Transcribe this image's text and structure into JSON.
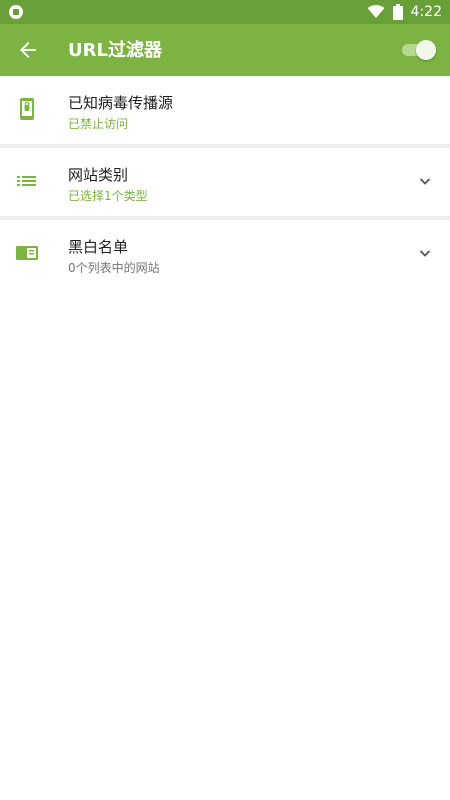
{
  "status_bar": {
    "time": "4:22"
  },
  "app_bar": {
    "title": "URL过滤器",
    "toggle_state": "on"
  },
  "list": {
    "items": [
      {
        "title": "已知病毒传播源",
        "subtitle": "已禁止访问",
        "subtitle_color": "#7cb342",
        "icon": "phone-shield-icon",
        "expandable": false
      },
      {
        "title": "网站类别",
        "subtitle": "已选择1个类型",
        "subtitle_color": "#7cb342",
        "icon": "list-icon",
        "expandable": true
      },
      {
        "title": "黑白名单",
        "subtitle": "0个列表中的网站",
        "subtitle_color": "#757575",
        "icon": "card-list-icon",
        "expandable": true
      }
    ]
  },
  "colors": {
    "primary": "#7cb342",
    "status_bar": "#689f38",
    "accent_light": "#b8d88f"
  }
}
